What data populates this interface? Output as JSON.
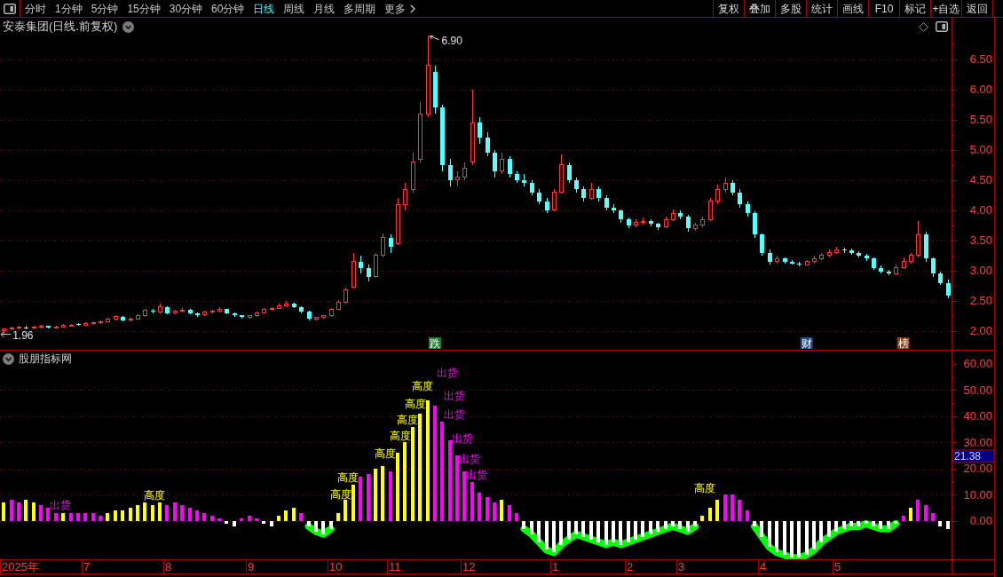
{
  "toolbar": {
    "periods": [
      {
        "label": "分时",
        "kind": "period",
        "selected": false
      },
      {
        "label": "1分钟",
        "kind": "period",
        "selected": false
      },
      {
        "label": "5分钟",
        "kind": "period",
        "selected": false
      },
      {
        "label": "15分钟",
        "kind": "period",
        "selected": false
      },
      {
        "label": "30分钟",
        "kind": "period",
        "selected": false
      },
      {
        "label": "60分钟",
        "kind": "period",
        "selected": false
      },
      {
        "label": "日线",
        "kind": "period",
        "selected": true
      },
      {
        "label": "周线",
        "kind": "period",
        "selected": false
      },
      {
        "label": "月线",
        "kind": "period",
        "selected": false
      },
      {
        "label": "多周期",
        "kind": "period",
        "selected": false
      },
      {
        "label": "更多",
        "kind": "more",
        "selected": false
      }
    ],
    "tools": [
      "复权",
      "叠加",
      "多股",
      "统计",
      "画线",
      "F10",
      "标记",
      "+自选",
      "返回"
    ]
  },
  "price_pane": {
    "title": "安泰集团(日线.前复权)",
    "chart_data": [
      {
        "type": "candlestick",
        "ylim": [
          1.69,
          7.19
        ],
        "yticks": [
          {
            "value": 2,
            "label": "2.00"
          },
          {
            "value": 2.5,
            "label": "2.50"
          },
          {
            "value": 3,
            "label": "3.00"
          },
          {
            "value": 3.5,
            "label": "3.50"
          },
          {
            "value": 4,
            "label": "4.00"
          },
          {
            "value": 4.5,
            "label": "4.50"
          },
          {
            "value": 5,
            "label": "5.00"
          },
          {
            "value": 5.5,
            "label": "5.50"
          },
          {
            "value": 6,
            "label": "6.00"
          },
          {
            "value": 6.5,
            "label": "6.50"
          }
        ],
        "grid": true,
        "annotations": [
          "6.90",
          "1.96"
        ],
        "ohlc": [
          [
            2.0,
            2.05,
            1.96,
            2.03
          ],
          [
            2.03,
            2.07,
            2.01,
            2.05
          ],
          [
            2.05,
            2.08,
            2.03,
            2.06
          ],
          [
            2.06,
            2.08,
            2.03,
            2.05
          ],
          [
            2.05,
            2.09,
            2.04,
            2.07
          ],
          [
            2.07,
            2.1,
            2.05,
            2.08
          ],
          [
            2.08,
            2.09,
            2.04,
            2.06
          ],
          [
            2.06,
            2.09,
            2.05,
            2.07
          ],
          [
            2.07,
            2.11,
            2.06,
            2.09
          ],
          [
            2.09,
            2.12,
            2.07,
            2.1
          ],
          [
            2.11,
            2.13,
            2.08,
            2.1
          ],
          [
            2.1,
            2.14,
            2.09,
            2.12
          ],
          [
            2.12,
            2.16,
            2.1,
            2.14
          ],
          [
            2.14,
            2.18,
            2.12,
            2.16
          ],
          [
            2.16,
            2.22,
            2.15,
            2.2
          ],
          [
            2.2,
            2.27,
            2.18,
            2.24
          ],
          [
            2.24,
            2.25,
            2.16,
            2.18
          ],
          [
            2.18,
            2.22,
            2.16,
            2.2
          ],
          [
            2.2,
            2.28,
            2.19,
            2.26
          ],
          [
            2.26,
            2.37,
            2.24,
            2.34
          ],
          [
            2.34,
            2.36,
            2.29,
            2.32
          ],
          [
            2.32,
            2.45,
            2.3,
            2.4
          ],
          [
            2.4,
            2.41,
            2.28,
            2.3
          ],
          [
            2.3,
            2.35,
            2.28,
            2.33
          ],
          [
            2.33,
            2.38,
            2.31,
            2.35
          ],
          [
            2.35,
            2.36,
            2.28,
            2.3
          ],
          [
            2.3,
            2.31,
            2.24,
            2.27
          ],
          [
            2.27,
            2.33,
            2.25,
            2.31
          ],
          [
            2.31,
            2.35,
            2.29,
            2.33
          ],
          [
            2.33,
            2.39,
            2.31,
            2.36
          ],
          [
            2.36,
            2.37,
            2.28,
            2.3
          ],
          [
            2.3,
            2.31,
            2.24,
            2.26
          ],
          [
            2.26,
            2.27,
            2.2,
            2.23
          ],
          [
            2.23,
            2.27,
            2.21,
            2.25
          ],
          [
            2.25,
            2.32,
            2.24,
            2.3
          ],
          [
            2.3,
            2.38,
            2.29,
            2.36
          ],
          [
            2.36,
            2.4,
            2.34,
            2.38
          ],
          [
            2.38,
            2.45,
            2.37,
            2.42
          ],
          [
            2.42,
            2.5,
            2.4,
            2.45
          ],
          [
            2.45,
            2.47,
            2.38,
            2.4
          ],
          [
            2.4,
            2.41,
            2.3,
            2.32
          ],
          [
            2.32,
            2.33,
            2.17,
            2.2
          ],
          [
            2.2,
            2.24,
            2.18,
            2.22
          ],
          [
            2.22,
            2.27,
            2.2,
            2.25
          ],
          [
            2.25,
            2.38,
            2.24,
            2.36
          ],
          [
            2.36,
            2.52,
            2.35,
            2.48
          ],
          [
            2.48,
            2.72,
            2.46,
            2.68
          ],
          [
            2.72,
            3.3,
            2.7,
            3.15
          ],
          [
            3.15,
            3.25,
            2.95,
            3.05
          ],
          [
            3.05,
            3.1,
            2.82,
            2.9
          ],
          [
            2.9,
            3.3,
            2.88,
            3.25
          ],
          [
            3.25,
            3.62,
            3.22,
            3.55
          ],
          [
            3.55,
            3.6,
            3.3,
            3.4
          ],
          [
            3.45,
            4.2,
            3.42,
            4.1
          ],
          [
            4.1,
            4.45,
            4.0,
            4.35
          ],
          [
            4.35,
            4.95,
            4.3,
            4.8
          ],
          [
            4.85,
            5.8,
            4.8,
            5.6
          ],
          [
            5.6,
            6.9,
            5.55,
            6.4
          ],
          [
            6.3,
            6.4,
            5.6,
            5.7
          ],
          [
            5.7,
            5.75,
            4.65,
            4.75
          ],
          [
            4.75,
            4.85,
            4.4,
            4.5
          ],
          [
            4.5,
            4.65,
            4.4,
            4.55
          ],
          [
            4.55,
            4.8,
            4.5,
            4.7
          ],
          [
            4.8,
            6.0,
            4.75,
            5.45
          ],
          [
            5.45,
            5.55,
            5.1,
            5.2
          ],
          [
            5.2,
            5.3,
            4.9,
            4.95
          ],
          [
            4.95,
            5.0,
            4.55,
            4.65
          ],
          [
            4.65,
            4.95,
            4.6,
            4.85
          ],
          [
            4.85,
            4.9,
            4.55,
            4.6
          ],
          [
            4.6,
            4.65,
            4.45,
            4.5
          ],
          [
            4.5,
            4.6,
            4.4,
            4.45
          ],
          [
            4.45,
            4.5,
            4.25,
            4.3
          ],
          [
            4.3,
            4.35,
            4.1,
            4.15
          ],
          [
            4.15,
            4.2,
            3.95,
            4.0
          ],
          [
            4.0,
            4.35,
            3.98,
            4.3
          ],
          [
            4.3,
            4.92,
            4.28,
            4.75
          ],
          [
            4.75,
            4.8,
            4.45,
            4.5
          ],
          [
            4.5,
            4.55,
            4.3,
            4.35
          ],
          [
            4.35,
            4.4,
            4.15,
            4.2
          ],
          [
            4.2,
            4.45,
            4.18,
            4.35
          ],
          [
            4.35,
            4.4,
            4.15,
            4.2
          ],
          [
            4.2,
            4.25,
            4.0,
            4.05
          ],
          [
            4.05,
            4.1,
            3.95,
            4.0
          ],
          [
            4.0,
            4.02,
            3.8,
            3.85
          ],
          [
            3.85,
            3.88,
            3.7,
            3.75
          ],
          [
            3.75,
            3.85,
            3.72,
            3.8
          ],
          [
            3.8,
            3.88,
            3.76,
            3.82
          ],
          [
            3.82,
            3.85,
            3.74,
            3.78
          ],
          [
            3.78,
            3.8,
            3.68,
            3.72
          ],
          [
            3.72,
            3.9,
            3.7,
            3.85
          ],
          [
            3.85,
            4.02,
            3.82,
            3.95
          ],
          [
            3.95,
            4.0,
            3.85,
            3.9
          ],
          [
            3.9,
            3.92,
            3.65,
            3.7
          ],
          [
            3.7,
            3.8,
            3.66,
            3.75
          ],
          [
            3.75,
            3.9,
            3.72,
            3.85
          ],
          [
            3.85,
            4.2,
            3.82,
            4.15
          ],
          [
            4.15,
            4.42,
            4.1,
            4.35
          ],
          [
            4.35,
            4.55,
            4.3,
            4.45
          ],
          [
            4.45,
            4.5,
            4.25,
            4.3
          ],
          [
            4.3,
            4.35,
            4.05,
            4.1
          ],
          [
            4.1,
            4.15,
            3.9,
            3.95
          ],
          [
            3.95,
            3.98,
            3.55,
            3.6
          ],
          [
            3.6,
            3.62,
            3.25,
            3.3
          ],
          [
            3.3,
            3.35,
            3.1,
            3.15
          ],
          [
            3.15,
            3.25,
            3.12,
            3.2
          ],
          [
            3.2,
            3.22,
            3.12,
            3.15
          ],
          [
            3.15,
            3.18,
            3.1,
            3.12
          ],
          [
            3.12,
            3.15,
            3.07,
            3.1
          ],
          [
            3.1,
            3.18,
            3.08,
            3.15
          ],
          [
            3.15,
            3.25,
            3.12,
            3.2
          ],
          [
            3.2,
            3.3,
            3.18,
            3.25
          ],
          [
            3.25,
            3.35,
            3.22,
            3.3
          ],
          [
            3.3,
            3.4,
            3.28,
            3.35
          ],
          [
            3.35,
            3.38,
            3.3,
            3.33
          ],
          [
            3.33,
            3.36,
            3.27,
            3.3
          ],
          [
            3.3,
            3.32,
            3.22,
            3.25
          ],
          [
            3.25,
            3.28,
            3.16,
            3.2
          ],
          [
            3.2,
            3.22,
            3.02,
            3.05
          ],
          [
            3.05,
            3.08,
            2.95,
            2.98
          ],
          [
            2.98,
            3.02,
            2.92,
            2.95
          ],
          [
            2.95,
            3.1,
            2.93,
            3.05
          ],
          [
            3.05,
            3.22,
            3.03,
            3.15
          ],
          [
            3.15,
            3.3,
            3.12,
            3.25
          ],
          [
            3.25,
            3.82,
            3.22,
            3.6
          ],
          [
            3.6,
            3.65,
            3.15,
            3.2
          ],
          [
            3.2,
            3.22,
            2.9,
            2.95
          ],
          [
            2.95,
            2.98,
            2.76,
            2.8
          ],
          [
            2.8,
            2.85,
            2.55,
            2.58
          ]
        ]
      }
    ],
    "events": [
      {
        "text": "跌",
        "color": "#1a7f34"
      },
      {
        "text": "财",
        "color": "#1f4f8c"
      },
      {
        "text": "榜",
        "color": "#8a3a14"
      }
    ]
  },
  "indicator_pane": {
    "title": "股朋指标网",
    "value_tag": "21.38",
    "chart_data": [
      {
        "type": "bar",
        "ylim": [
          -14.58,
          65.08
        ],
        "yticks": [
          {
            "value": 0,
            "label": "0.00"
          },
          {
            "value": 10,
            "label": "10.00"
          },
          {
            "value": 20,
            "label": "20.00"
          },
          {
            "value": 30,
            "label": "30.00"
          },
          {
            "value": 40,
            "label": "40.00"
          },
          {
            "value": 50,
            "label": "50.00"
          },
          {
            "value": 60,
            "label": "60.00"
          }
        ],
        "grid": true,
        "values": [
          7,
          8,
          7,
          8,
          7,
          6,
          5,
          3,
          3,
          3,
          3,
          3,
          3,
          2,
          3,
          4,
          4,
          5,
          6,
          7,
          6,
          7,
          6,
          7,
          6,
          5,
          4,
          3,
          2,
          1,
          -1,
          -2,
          1,
          2,
          1,
          -1,
          -2,
          2,
          4,
          5,
          3,
          -2,
          -4,
          -5,
          -3,
          3,
          8,
          14,
          17,
          18,
          20,
          21,
          19,
          26,
          30,
          36,
          41,
          46,
          44,
          38,
          31,
          25,
          19,
          15,
          11,
          9,
          7,
          8,
          6,
          3,
          -3,
          -5,
          -8,
          -11,
          -12,
          -9,
          -7,
          -5,
          -6,
          -7,
          -8,
          -9,
          -8,
          -9,
          -8,
          -7,
          -6,
          -5,
          -4,
          -3,
          -2,
          -3,
          -4,
          -2,
          2,
          5,
          8,
          10,
          10,
          8,
          4,
          -2,
          -6,
          -10,
          -12,
          -13,
          -14,
          -14,
          -13,
          -11,
          -8,
          -6,
          -4,
          -3,
          -2,
          -2,
          -1,
          -2,
          -3,
          -3,
          -1,
          2,
          5,
          8,
          6,
          3,
          -2,
          -3
        ],
        "colors": [
          "#ffff00",
          "#ff00ff",
          "#ff00ff",
          "#ffff00",
          "#ffff00",
          "#ff00ff",
          "#ff00ff",
          "#ff00ff",
          "#ffff00",
          "#ff00ff",
          "#ff00ff",
          "#ff00ff",
          "#ff00ff",
          "#ff00ff",
          "#ffff00",
          "#ffff00",
          "#ffff00",
          "#ffff00",
          "#ffff00",
          "#ffff00",
          "#ffff00",
          "#ffff00",
          "#ff00ff",
          "#ff00ff",
          "#ff00ff",
          "#ff00ff",
          "#ff00ff",
          "#ff00ff",
          "#ff00ff",
          "#ff00ff",
          "#ffffff",
          "#ffffff",
          "#ff00ff",
          "#ff00ff",
          "#ff00ff",
          "#ffffff",
          "#ffffff",
          "#ffff00",
          "#ffff00",
          "#ffff00",
          "#ff00ff",
          "#ffffff",
          "#ffffff",
          "#ffffff",
          "#ffffff",
          "#ffff00",
          "#ffff00",
          "#ffff00",
          "#ff00ff",
          "#ff00ff",
          "#ffff00",
          "#ffff00",
          "#ff00ff",
          "#ffff00",
          "#ffff00",
          "#ffff00",
          "#ffff00",
          "#ffff00",
          "#ff00ff",
          "#ff00ff",
          "#ff00ff",
          "#ff00ff",
          "#ff00ff",
          "#ff00ff",
          "#ff00ff",
          "#ff00ff",
          "#ff00ff",
          "#ffff00",
          "#ff00ff",
          "#ff00ff",
          "#ffffff",
          "#ffffff",
          "#ffffff",
          "#ffffff",
          "#ffffff",
          "#ffffff",
          "#ffffff",
          "#ffffff",
          "#ffffff",
          "#ffffff",
          "#ffffff",
          "#ffffff",
          "#ffffff",
          "#ffffff",
          "#ffffff",
          "#ffffff",
          "#ffffff",
          "#ffffff",
          "#ffffff",
          "#ffffff",
          "#ffffff",
          "#ffffff",
          "#ffffff",
          "#ffffff",
          "#ffff00",
          "#ffff00",
          "#ffff00",
          "#ff00ff",
          "#ff00ff",
          "#ff00ff",
          "#ff00ff",
          "#ffffff",
          "#ffffff",
          "#ffffff",
          "#ffffff",
          "#ffffff",
          "#ffffff",
          "#ffffff",
          "#ffffff",
          "#ffffff",
          "#ffffff",
          "#ffffff",
          "#ffffff",
          "#ffffff",
          "#ffffff",
          "#ffffff",
          "#ffffff",
          "#ffffff",
          "#ffffff",
          "#ffffff",
          "#ffffff",
          "#ff00ff",
          "#ffff00",
          "#ff00ff",
          "#ff00ff",
          "#ff00ff",
          "#ffffff",
          "#ffffff"
        ]
      }
    ],
    "signals": [
      {
        "text": "出货",
        "kind": "fall"
      },
      {
        "text": "高度",
        "kind": "rise"
      },
      {
        "text": "出货",
        "kind": "fall"
      },
      {
        "text": "高度",
        "kind": "rise"
      },
      {
        "text": "出货",
        "kind": "fall"
      },
      {
        "text": "高度",
        "kind": "rise"
      },
      {
        "text": "高度",
        "kind": "rise"
      },
      {
        "text": "出货",
        "kind": "fall"
      },
      {
        "text": "高度",
        "kind": "rise"
      },
      {
        "text": "出货",
        "kind": "fall"
      },
      {
        "text": "出货",
        "kind": "fall"
      },
      {
        "text": "高度",
        "kind": "rise"
      },
      {
        "text": "高度",
        "kind": "rise"
      },
      {
        "text": "出货",
        "kind": "fall"
      },
      {
        "text": "高度",
        "kind": "rise"
      },
      {
        "text": "高度",
        "kind": "rise"
      }
    ]
  },
  "time_axis": {
    "labels": [
      "2025年",
      "7",
      "8",
      "9",
      "10",
      "11",
      "12",
      "1",
      "2",
      "3",
      "4",
      "5"
    ]
  }
}
